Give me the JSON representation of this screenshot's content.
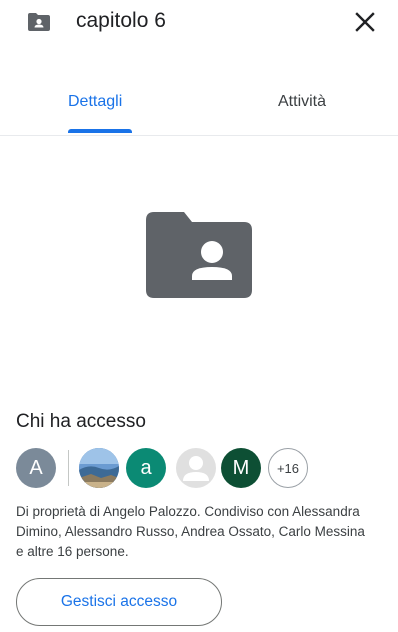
{
  "header": {
    "title": "capitolo 6",
    "folder_icon": "shared-folder-icon",
    "close_icon": "close-icon"
  },
  "tabs": [
    {
      "label": "Dettagli",
      "active": true
    },
    {
      "label": "Attività",
      "active": false
    }
  ],
  "preview": {
    "icon": "shared-folder-icon"
  },
  "access": {
    "heading": "Chi ha accesso",
    "owner_avatar": "A",
    "shared_avatars": [
      {
        "type": "photo"
      },
      {
        "type": "letter",
        "letter": "a"
      },
      {
        "type": "placeholder"
      },
      {
        "type": "letter",
        "letter": "M"
      }
    ],
    "more_count": "+16",
    "description": "Di proprietà di Angelo Palozzo. Condiviso con Alessandra Dimino, Alessandro Russo, Andrea Ossato, Carlo Messina e altre 16 persone.",
    "manage_label": "Gestisci accesso"
  },
  "colors": {
    "accent": "#1a73e8",
    "folder": "#5f6368",
    "owner_avatar_bg": "#7b8a99",
    "teal_avatar_bg": "#0b8a74",
    "m_avatar_bg": "#0d4f34"
  }
}
